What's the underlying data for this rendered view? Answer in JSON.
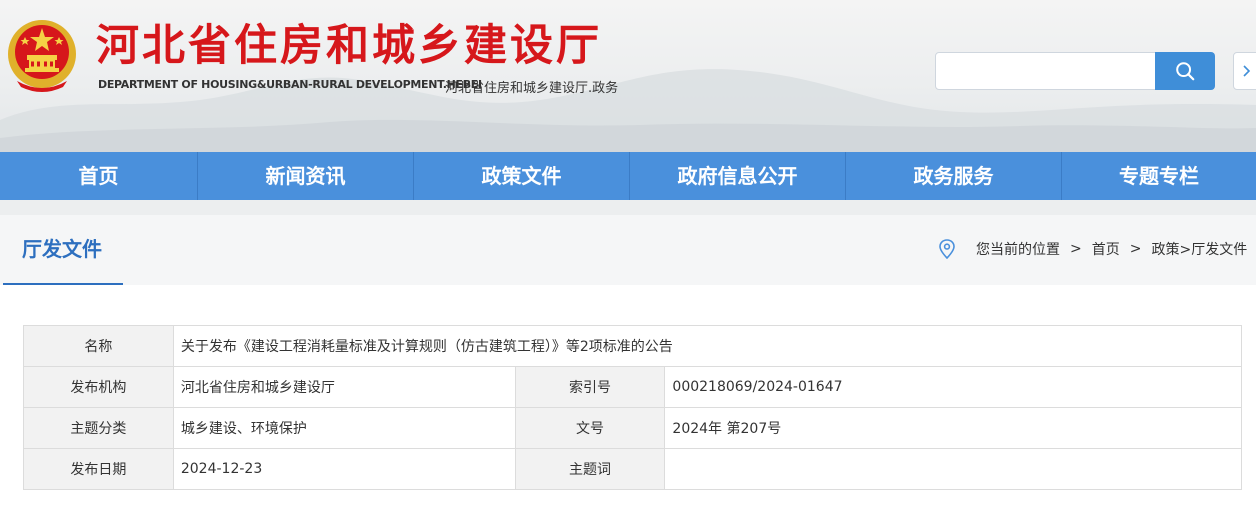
{
  "header": {
    "title": "河北省住房和城乡建设厅",
    "subtitle_en": "DEPARTMENT OF HOUSING&URBAN-RURAL DEVELOPMENT.HEBEI",
    "domain_label": "河北省住房和城乡建设厅.政务",
    "search_placeholder": "",
    "search_icon": "search-icon",
    "emblem_icon": "national-emblem-icon"
  },
  "nav": {
    "items": [
      "首页",
      "新闻资讯",
      "政策文件",
      "政府信息公开",
      "政务服务",
      "专题专栏"
    ]
  },
  "section": {
    "title": "厅发文件",
    "breadcrumb": {
      "prefix": "您当前的位置",
      "sep1": ">",
      "home": "首页",
      "sep2": ">",
      "current": "政策>厅发文件"
    }
  },
  "info": {
    "name_label": "名称",
    "name_value": "关于发布《建设工程消耗量标准及计算规则（仿古建筑工程）》等2项标准的公告",
    "org_label": "发布机构",
    "org_value": "河北省住房和城乡建设厅",
    "index_label": "索引号",
    "index_value": "000218069/2024-01647",
    "topic_label": "主题分类",
    "topic_value": "城乡建设、环境保护",
    "docno_label": "文号",
    "docno_value": "2024年 第207号",
    "date_label": "发布日期",
    "date_value": "2024-12-23",
    "keyword_label": "主题词",
    "keyword_value": ""
  },
  "colors": {
    "title_red": "#d6171b",
    "nav_blue": "#4a90dc",
    "accent_blue": "#2d6fbf"
  }
}
